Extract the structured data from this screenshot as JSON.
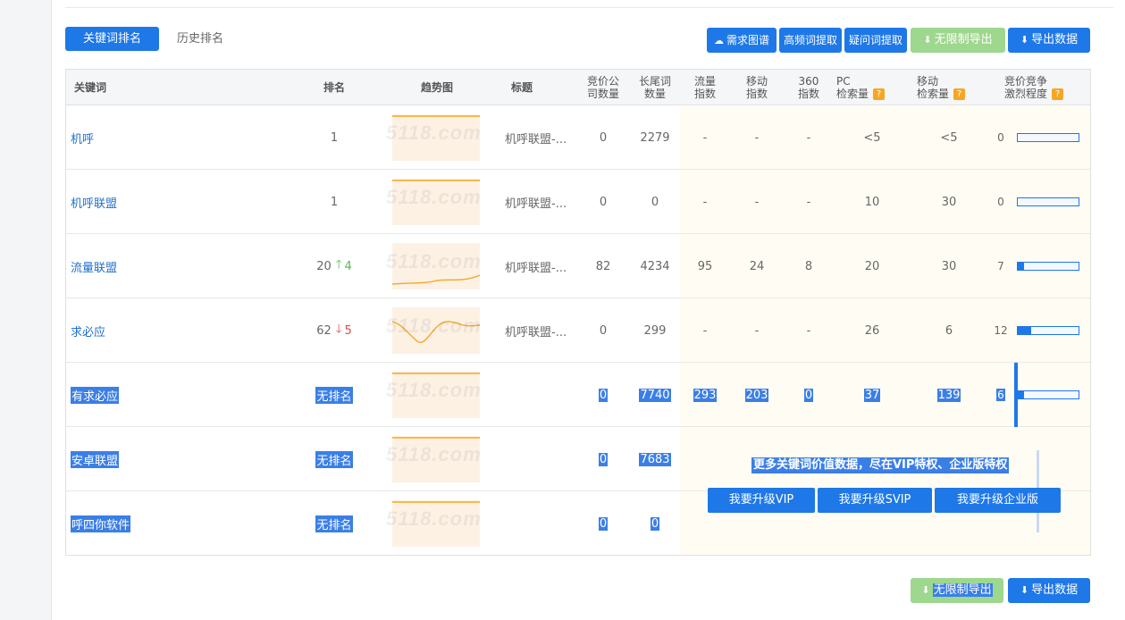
{
  "tabs": {
    "active": "关键词排名",
    "inactive": "历史排名"
  },
  "toolbar": {
    "demand_map": "需求图谱",
    "high_freq": "高频词提取",
    "question_words": "疑问词提取",
    "unlimited_export": "无限制导出",
    "export_data": "导出数据"
  },
  "headers": {
    "keyword": "关键词",
    "rank": "排名",
    "trend": "趋势图",
    "title": "标题",
    "bid_companies": [
      "竞价公",
      "司数量"
    ],
    "long_tail": [
      "长尾词",
      "数量"
    ],
    "traffic": [
      "流量",
      "指数"
    ],
    "mobile": [
      "移动",
      "指数"
    ],
    "s360": [
      "360",
      "指数"
    ],
    "pc_search": [
      "PC",
      "检索量"
    ],
    "mobile_search": [
      "移动",
      "检索量"
    ],
    "competition": [
      "竞价竞争",
      "激烈程度"
    ],
    "help": "?"
  },
  "watermark": "5118.com",
  "rows": [
    {
      "keyword": "机呼",
      "rank": "1",
      "change": "",
      "dir": "",
      "title": "机呼联盟-...",
      "bid": "0",
      "longtail": "2279",
      "traffic": "-",
      "mobile": "-",
      "s360": "-",
      "pc": "<5",
      "msearch": "<5",
      "comp": "0",
      "comp_level": 0,
      "trend": "flat"
    },
    {
      "keyword": "机呼联盟",
      "rank": "1",
      "change": "",
      "dir": "",
      "title": "机呼联盟-...",
      "bid": "0",
      "longtail": "0",
      "traffic": "-",
      "mobile": "-",
      "s360": "-",
      "pc": "10",
      "msearch": "30",
      "comp": "0",
      "comp_level": 0,
      "trend": "flat"
    },
    {
      "keyword": "流量联盟",
      "rank": "20",
      "change": "4",
      "dir": "up",
      "title": "机呼联盟-...",
      "bid": "82",
      "longtail": "4234",
      "traffic": "95",
      "mobile": "24",
      "s360": "8",
      "pc": "20",
      "msearch": "30",
      "comp": "7",
      "comp_level": 0.1,
      "trend": "rise"
    },
    {
      "keyword": "求必应",
      "rank": "62",
      "change": "5",
      "dir": "down",
      "title": "机呼联盟-...",
      "bid": "0",
      "longtail": "299",
      "traffic": "-",
      "mobile": "-",
      "s360": "-",
      "pc": "26",
      "msearch": "6",
      "comp": "12",
      "comp_level": 0.22,
      "trend": "dip"
    },
    {
      "keyword": "有求必应",
      "rank": "无排名",
      "change": "",
      "dir": "",
      "title": "",
      "bid": "0",
      "longtail": "7740",
      "traffic": "293",
      "mobile": "203",
      "s360": "0",
      "pc": "37",
      "msearch": "139",
      "comp": "6",
      "comp_level": 0.1,
      "trend": "flat",
      "selected": true
    },
    {
      "keyword": "安卓联盟",
      "rank": "无排名",
      "change": "",
      "dir": "",
      "title": "",
      "bid": "0",
      "longtail": "7683",
      "traffic": "",
      "mobile": "",
      "s360": "",
      "pc": "",
      "msearch": "",
      "comp": "",
      "comp_level": null,
      "trend": "flat",
      "selected": true
    },
    {
      "keyword": "呼四你软件",
      "rank": "无排名",
      "change": "",
      "dir": "",
      "title": "",
      "bid": "0",
      "longtail": "0",
      "traffic": "",
      "mobile": "",
      "s360": "",
      "pc": "",
      "msearch": "",
      "comp": "",
      "comp_level": null,
      "trend": "flat",
      "selected": true
    }
  ],
  "vip": {
    "title": "更多关键词价值数据，尽在VIP特权、企业版特权",
    "btn_vip": "我要升级VIP",
    "btn_svip": "我要升级SVIP",
    "btn_enterprise": "我要升级企业版"
  },
  "footer": {
    "unlimited_export": "无限制导出",
    "export_data": "导出数据"
  },
  "colors": {
    "primary": "#1e78e8",
    "green": "#9ed78e",
    "up": "#52b84a",
    "down": "#e04a4a",
    "spark": "#f5a623"
  },
  "icons": {
    "cloud": "cloud-icon",
    "download": "download-icon"
  }
}
